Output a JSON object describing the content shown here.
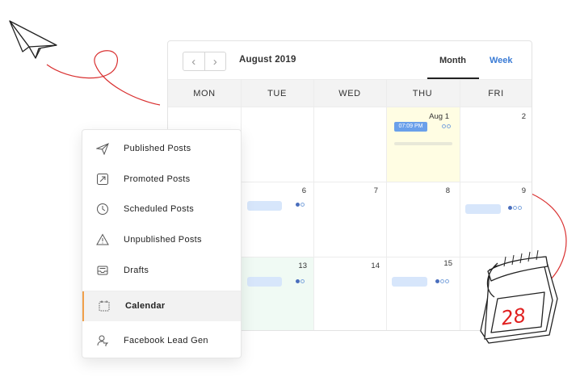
{
  "calendar": {
    "month_title": "August 2019",
    "prev_icon": "chevron-left-icon",
    "next_icon": "chevron-right-icon",
    "views": {
      "month": "Month",
      "week": "Week"
    },
    "weekdays": [
      "MON",
      "TUE",
      "WED",
      "THU",
      "FRI"
    ],
    "dates": {
      "aug1": "Aug 1",
      "d2": "2",
      "d6": "6",
      "d7": "7",
      "d8": "8",
      "d9": "9",
      "d13": "13",
      "d14": "14",
      "d15": "15"
    },
    "event_time": "07:09 PM",
    "colors": {
      "accent": "#3a7bd5",
      "today_bg": "#fffde3",
      "highlight_bg": "#f0faf4",
      "chip": "#6aa0ea"
    }
  },
  "menu": {
    "items": [
      {
        "label": "Published Posts",
        "icon": "paper-plane-icon"
      },
      {
        "label": "Promoted Posts",
        "icon": "arrow-up-right-icon"
      },
      {
        "label": "Scheduled Posts",
        "icon": "clock-icon"
      },
      {
        "label": "Unpublished Posts",
        "icon": "warning-icon"
      },
      {
        "label": "Drafts",
        "icon": "inbox-tray-icon"
      },
      {
        "label": "Calendar",
        "icon": "calendar-icon"
      },
      {
        "label": "Facebook Lead Gen",
        "icon": "user-funnel-icon"
      }
    ],
    "active_index": 5,
    "active_color": "#f0a04b"
  },
  "illustration": {
    "calendar_page_number": "28"
  }
}
